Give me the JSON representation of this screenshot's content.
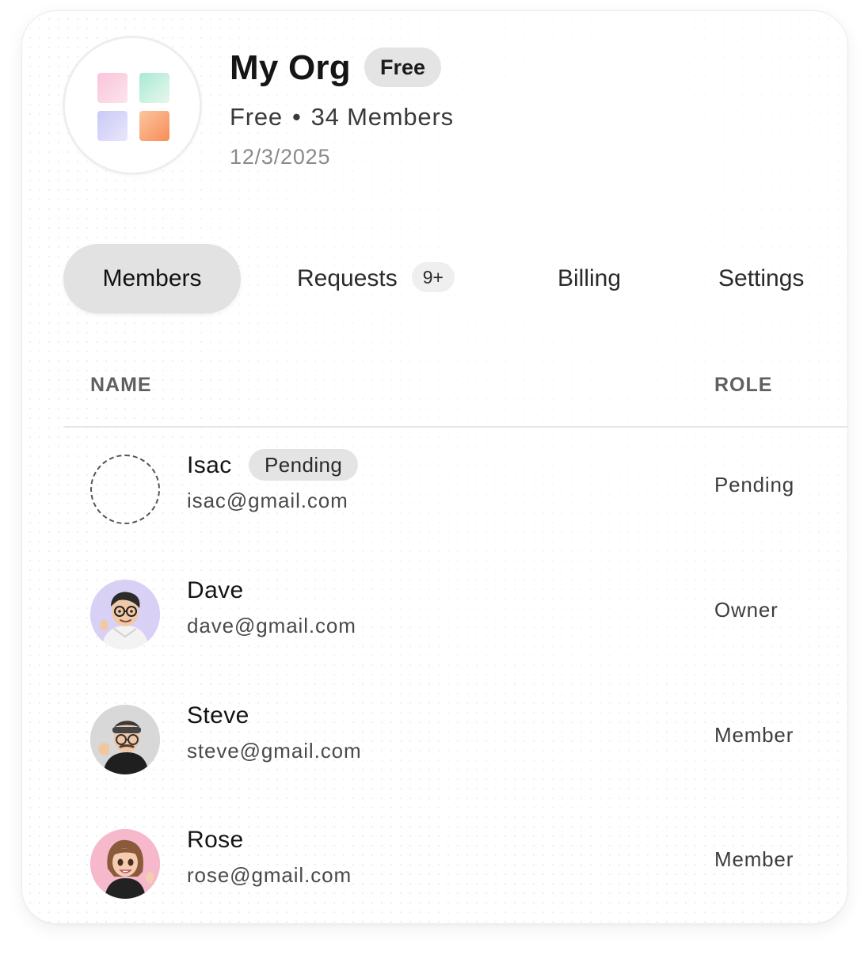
{
  "org": {
    "name": "My Org",
    "plan_badge": "Free",
    "plan": "Free",
    "separator": "•",
    "members_count": "34 Members",
    "date": "12/3/2025",
    "logo_icon": "four-square-grid-logo"
  },
  "tabs": [
    {
      "label": "Members",
      "active": true
    },
    {
      "label": "Requests",
      "badge": "9+",
      "active": false
    },
    {
      "label": "Billing",
      "active": false
    },
    {
      "label": "Settings",
      "active": false
    }
  ],
  "table": {
    "columns": {
      "name": "NAME",
      "role": "ROLE"
    },
    "rows": [
      {
        "name": "Isac",
        "status": "Pending",
        "email": "isac@gmail.com",
        "role": "Pending",
        "avatar": "pending-placeholder-icon"
      },
      {
        "name": "Dave",
        "email": "dave@gmail.com",
        "role": "Owner",
        "avatar": "memoji-dave"
      },
      {
        "name": "Steve",
        "email": "steve@gmail.com",
        "role": "Member",
        "avatar": "memoji-steve"
      },
      {
        "name": "Rose",
        "email": "rose@gmail.com",
        "role": "Member",
        "avatar": "memoji-rose"
      }
    ]
  },
  "colors": {
    "tab_active_bg": "#e2e2e2",
    "badge_bg": "#e4e4e4",
    "dave_avatar_bg": "#d9d0f6",
    "steve_avatar_bg": "#d8d8d8",
    "rose_avatar_bg": "#f6b9cc"
  }
}
